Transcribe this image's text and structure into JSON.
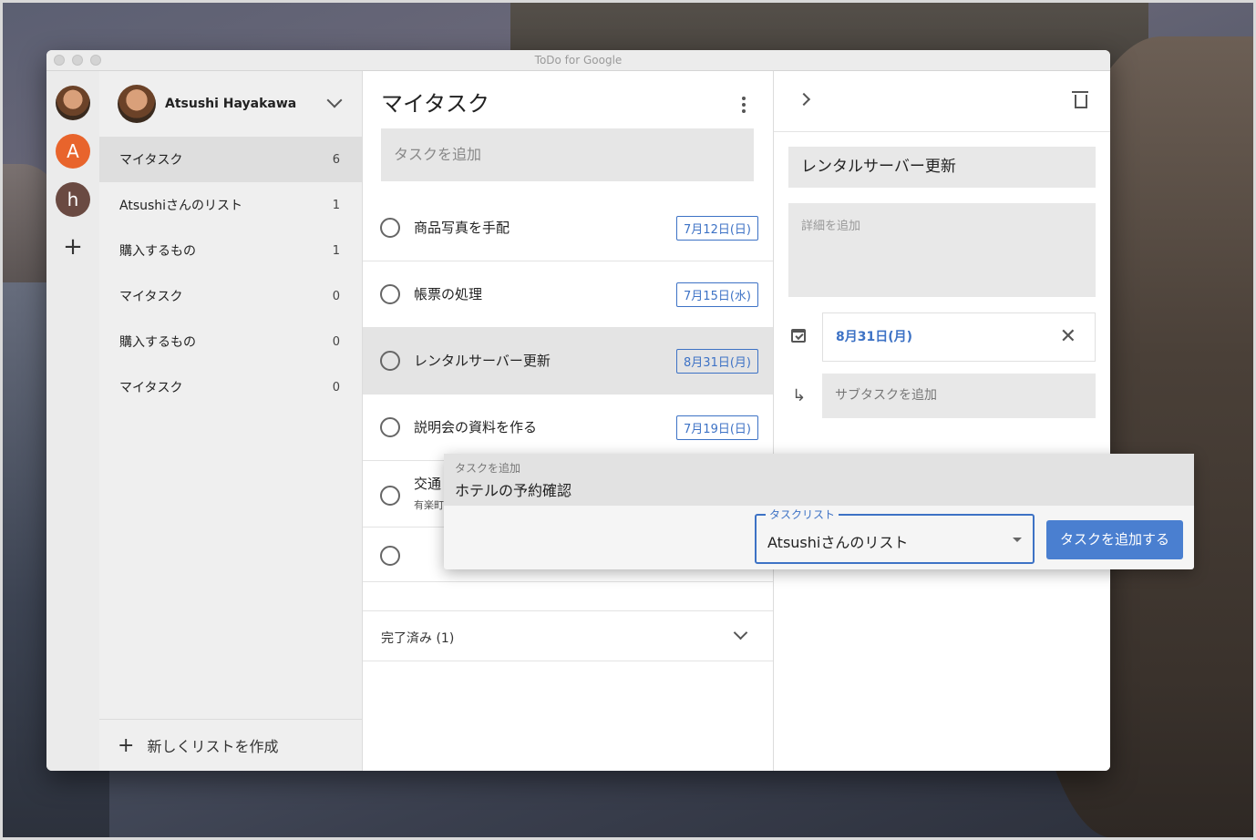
{
  "window": {
    "title": "ToDo for Google"
  },
  "account": {
    "name": "Atsushi Hayakawa"
  },
  "rail": {
    "avatar_a": "A",
    "avatar_h": "h",
    "add": "+"
  },
  "lists": [
    {
      "label": "マイタスク",
      "count": "6"
    },
    {
      "label": "Atsushiさんのリスト",
      "count": "1"
    },
    {
      "label": "購入するもの",
      "count": "1"
    },
    {
      "label": "マイタスク",
      "count": "0"
    },
    {
      "label": "購入するもの",
      "count": "0"
    },
    {
      "label": "マイタスク",
      "count": "0"
    }
  ],
  "new_list": {
    "plus": "+",
    "label": "新しくリストを作成"
  },
  "tasks_pane": {
    "title": "マイタスク",
    "add_placeholder": "タスクを追加",
    "tasks": [
      {
        "title": "商品写真を手配",
        "date": "7月12日(日)"
      },
      {
        "title": "帳票の処理",
        "date": "7月15日(水)"
      },
      {
        "title": "レンタルサーバー更新",
        "date": "8月31日(月)"
      },
      {
        "title": "説明会の資料を作る",
        "date": "7月19日(日)"
      },
      {
        "title": "交通",
        "sub": "有楽町"
      },
      {
        "title": ""
      }
    ],
    "completed_label": "完了済み (1)"
  },
  "detail": {
    "title": "レンタルサーバー更新",
    "notes_placeholder": "詳細を追加",
    "date": "8月31日(月)",
    "clear": "✕",
    "subtask_placeholder": "サブタスクを追加",
    "subtask_icon": "↳"
  },
  "quick_add": {
    "label": "タスクを追加",
    "value": "ホテルの予約確認",
    "list_legend": "タスクリスト",
    "list_value": "Atsushiさんのリスト",
    "button": "タスクを追加する"
  },
  "colors": {
    "accent": "#3d72c5",
    "button": "#4a7fd0",
    "avatar_a": "#e8642c"
  }
}
